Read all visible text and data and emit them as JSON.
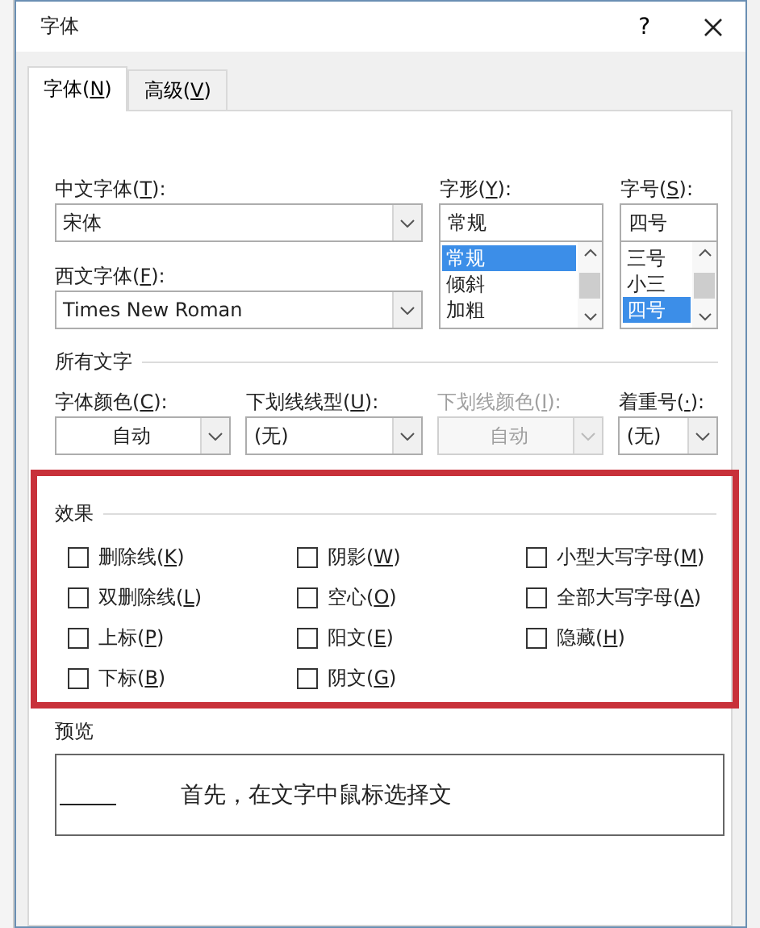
{
  "window": {
    "title": "字体",
    "help": "?"
  },
  "tabs": [
    {
      "before": "字体(",
      "key": "N",
      "after": ")",
      "selected": true
    },
    {
      "before": "高级(",
      "key": "V",
      "after": ")",
      "selected": false
    }
  ],
  "chinese_font": {
    "before": "中文字体(",
    "key": "T",
    "after": "):",
    "value": "宋体"
  },
  "western_font": {
    "before": "西文字体(",
    "key": "F",
    "after": "):",
    "value": "Times New Roman"
  },
  "style": {
    "before": "字形(",
    "key": "Y",
    "after": "):",
    "value": "常规",
    "options": [
      {
        "text": "常规",
        "selected": true
      },
      {
        "text": "倾斜",
        "selected": false
      },
      {
        "text": "加粗",
        "selected": false
      }
    ]
  },
  "size": {
    "before": "字号(",
    "key": "S",
    "after": "):",
    "value": "四号",
    "options": [
      {
        "text": "三号",
        "selected": false
      },
      {
        "text": "小三",
        "selected": false
      },
      {
        "text": "四号",
        "selected": true
      }
    ]
  },
  "all_text": {
    "title": "所有文字",
    "fields": [
      {
        "before": "字体颜色(",
        "key": "C",
        "after": "):",
        "value": "自动",
        "kind": "color",
        "disabled": false
      },
      {
        "before": "下划线线型(",
        "key": "U",
        "after": "):",
        "value": "(无)",
        "kind": "list",
        "disabled": false
      },
      {
        "before": "下划线颜色(",
        "key": "I",
        "after": "):",
        "value": "自动",
        "kind": "color",
        "disabled": true
      },
      {
        "before": "着重号(",
        "key": "·",
        "after": "):",
        "value": "(无)",
        "kind": "list",
        "disabled": false
      }
    ]
  },
  "effects": {
    "title": "效果",
    "options": [
      {
        "before": "删除线(",
        "key": "K",
        "after": ")",
        "checked": false
      },
      {
        "before": "阴影(",
        "key": "W",
        "after": ")",
        "checked": false
      },
      {
        "before": "小型大写字母(",
        "key": "M",
        "after": ")",
        "checked": false
      },
      {
        "before": "双删除线(",
        "key": "L",
        "after": ")",
        "checked": false
      },
      {
        "before": "空心(",
        "key": "O",
        "after": ")",
        "checked": false
      },
      {
        "before": "全部大写字母(",
        "key": "A",
        "after": ")",
        "checked": false
      },
      {
        "before": "上标(",
        "key": "P",
        "after": ")",
        "checked": false
      },
      {
        "before": "阳文(",
        "key": "E",
        "after": ")",
        "checked": false
      },
      {
        "before": "隐藏(",
        "key": "H",
        "after": ")",
        "checked": false
      },
      {
        "before": "下标(",
        "key": "B",
        "after": ")",
        "checked": false
      },
      {
        "before": "阴文(",
        "key": "G",
        "after": ")",
        "checked": false
      }
    ]
  },
  "preview": {
    "title": "预览",
    "text": "首先，在文字中鼠标选择文"
  }
}
